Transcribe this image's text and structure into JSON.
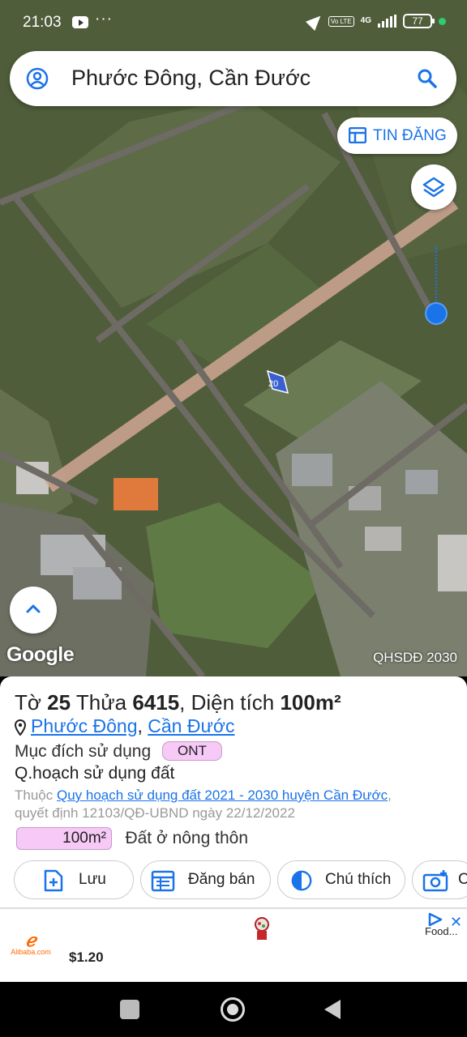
{
  "status_bar": {
    "time": "21:03",
    "dots": "···",
    "volte": "Vo LTE",
    "network": "4G",
    "battery": "77"
  },
  "search": {
    "value": "Phước Đông, Cần Đước"
  },
  "map": {
    "tin_dang_label": "TIN ĐĂNG",
    "google_logo": "Google",
    "layer_label": "QHSDĐ 2030",
    "parcel_number": "20"
  },
  "info": {
    "sheet_prefix": "Tờ",
    "sheet_no": "25",
    "parcel_prefix": "Thửa",
    "parcel_no": "6415",
    "area_prefix": ", Diện tích",
    "area_value": "100m²",
    "commune": "Phước Đông",
    "separator": ", ",
    "district": "Cần Đước",
    "purpose_label": "Mục đích sử dụng",
    "purpose_code": "ONT",
    "plan_label": "Q.hoạch sử dụng đất",
    "belongs_prefix": "Thuộc",
    "plan_link": "Quy hoạch sử dụng đất 2021 - 2030 huyện Cần Đước",
    "decision_text": "quyết định 12103/QĐ-UBND ngày 22/12/2022",
    "plan_area": "100m²",
    "plan_type": "Đất ở nông thôn"
  },
  "actions": {
    "save": "Lưu",
    "sell": "Đăng bán",
    "legend": "Chú thích",
    "photo": "C"
  },
  "ad": {
    "brand": "Alibaba.com",
    "price": "$1.20",
    "advertiser": "Food..."
  },
  "colors": {
    "accent": "#1a73e8",
    "badge_fill": "#f6c9f6",
    "ad_brand": "#ff6a00"
  }
}
